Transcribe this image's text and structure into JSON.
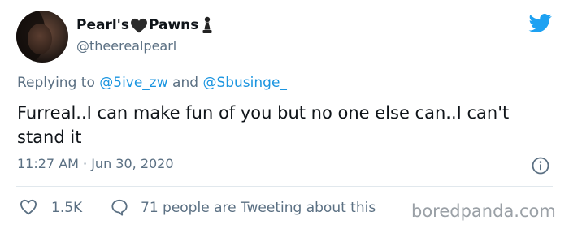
{
  "tweet": {
    "display_name_part1": "Pearl's",
    "display_name_part2": "Pawns",
    "handle": "@theerealpearl",
    "reply_prefix": "Replying to",
    "reply_mention_1": "@5ive_zw",
    "reply_and": "and",
    "reply_mention_2": "@Sbusinge_",
    "text": "Furreal..I can make fun of you but no one else can..I can't stand it",
    "timestamp": "11:27 AM · Jun 30, 2020",
    "likes": "1.5K",
    "people_tweeting": "71 people are Tweeting about this"
  },
  "watermark": "boredpanda.com",
  "icons": {
    "avatar": "profile-photo",
    "heart_emoji": "black-heart-icon",
    "pawn_emoji": "chess-pawn-icon",
    "logo": "twitter-bird-icon",
    "info": "info-icon",
    "like": "heart-outline-icon",
    "reply": "speech-bubble-icon"
  },
  "colors": {
    "twitter_blue": "#1da1f2",
    "mention_blue": "#1b95e0",
    "secondary_text": "#5b7083",
    "primary_text": "#0f1419"
  }
}
